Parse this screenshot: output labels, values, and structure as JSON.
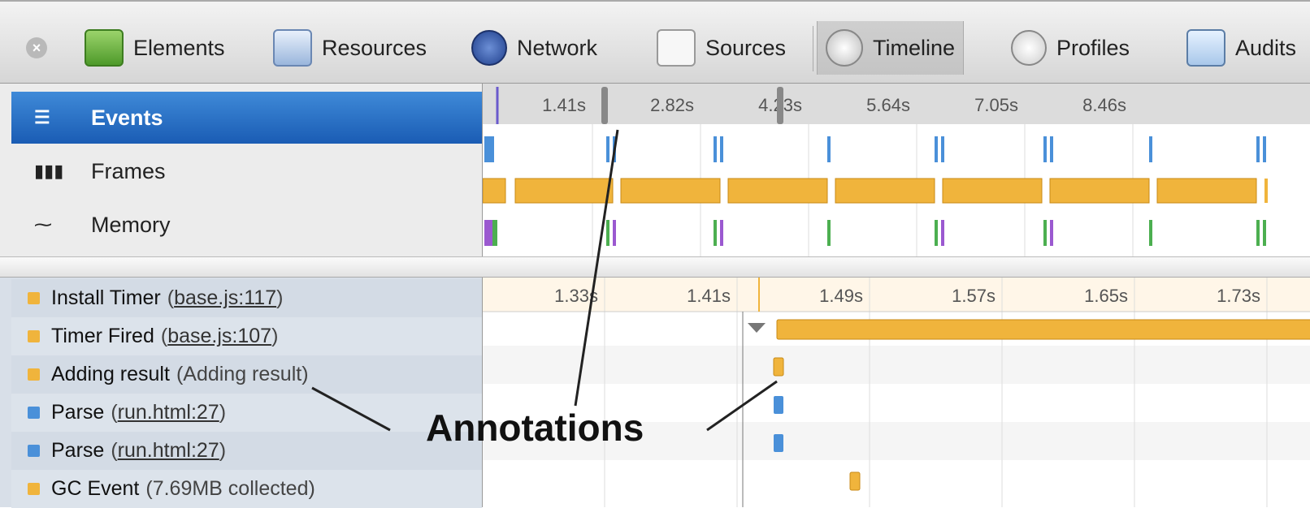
{
  "toolbar": {
    "tabs": [
      {
        "label": "Elements",
        "icon": "elements-icon"
      },
      {
        "label": "Resources",
        "icon": "resources-icon"
      },
      {
        "label": "Network",
        "icon": "network-icon"
      },
      {
        "label": "Sources",
        "icon": "sources-icon"
      },
      {
        "label": "Timeline",
        "icon": "timeline-icon",
        "active": true
      },
      {
        "label": "Profiles",
        "icon": "profiles-icon"
      },
      {
        "label": "Audits",
        "icon": "audits-icon"
      }
    ]
  },
  "overview": {
    "items": [
      {
        "label": "Events",
        "icon": "events-icon",
        "selected": true
      },
      {
        "label": "Frames",
        "icon": "frames-icon"
      },
      {
        "label": "Memory",
        "icon": "memory-icon"
      }
    ],
    "ticks": [
      "1.41s",
      "2.82s",
      "4.23s",
      "5.64s",
      "7.05s",
      "8.46s"
    ]
  },
  "records": {
    "ticks": [
      "1.33s",
      "1.41s",
      "1.49s",
      "1.57s",
      "1.65s",
      "1.73s"
    ],
    "rows": [
      {
        "title": "Install Timer",
        "detail": "base.js:117",
        "link": true,
        "color": "#f0b43c"
      },
      {
        "title": "Timer Fired",
        "detail": "base.js:107",
        "link": true,
        "color": "#f0b43c"
      },
      {
        "title": "Adding result",
        "detail": "Adding result",
        "link": false,
        "color": "#f0b43c"
      },
      {
        "title": "Parse",
        "detail": "run.html:27",
        "link": true,
        "color": "#4a90d9"
      },
      {
        "title": "Parse",
        "detail": "run.html:27",
        "link": true,
        "color": "#4a90d9"
      },
      {
        "title": "GC Event",
        "detail": "7.69MB collected",
        "link": false,
        "color": "#f0b43c"
      }
    ]
  },
  "annotation_text": "Annotations",
  "colors": {
    "scripting": "#f0b43c",
    "loading": "#4a90d9",
    "rendering": "#9b59d0",
    "painting": "#4caf50",
    "selected": "#1a5cb4"
  }
}
